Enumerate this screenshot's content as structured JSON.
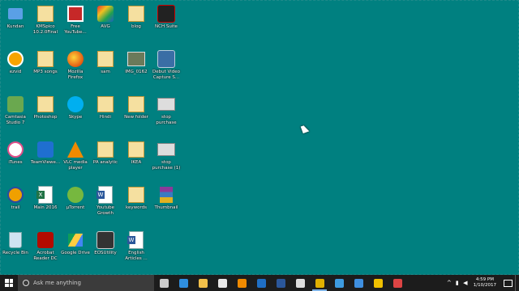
{
  "desktop": {
    "icons": [
      {
        "label": "Kundan",
        "icon": "user-folder-icon"
      },
      {
        "label": "KMSpico 10.2.0Final",
        "icon": "folder-icon"
      },
      {
        "label": "Free YouTube...",
        "icon": "free-youtube-icon"
      },
      {
        "label": "AVG",
        "icon": "avg-icon"
      },
      {
        "label": "blog",
        "icon": "folder-icon"
      },
      {
        "label": "NCH Suite",
        "icon": "nch-suite-icon"
      },
      {
        "label": "ezvid",
        "icon": "ezvid-icon"
      },
      {
        "label": "MP3 songs",
        "icon": "folder-icon"
      },
      {
        "label": "Mozilla Firefox",
        "icon": "firefox-icon"
      },
      {
        "label": "sam",
        "icon": "folder-icon"
      },
      {
        "label": "IMG_0162",
        "icon": "image-file-icon"
      },
      {
        "label": "Debut Video Capture S...",
        "icon": "debut-video-icon"
      },
      {
        "label": "Camtasia Studio 7",
        "icon": "camtasia-icon"
      },
      {
        "label": "Photoshop",
        "icon": "folder-icon"
      },
      {
        "label": "Skype",
        "icon": "skype-icon"
      },
      {
        "label": "Hindi",
        "icon": "folder-icon"
      },
      {
        "label": "New folder",
        "icon": "folder-icon"
      },
      {
        "label": "stop purchase",
        "icon": "image-file-icon"
      },
      {
        "label": "iTunes",
        "icon": "itunes-icon"
      },
      {
        "label": "TeamViewe...",
        "icon": "teamviewer-icon"
      },
      {
        "label": "VLC media player",
        "icon": "vlc-icon"
      },
      {
        "label": "PA analytic",
        "icon": "folder-icon"
      },
      {
        "label": "IKEA",
        "icon": "folder-icon"
      },
      {
        "label": "stop purchase (1)",
        "icon": "image-file-icon"
      },
      {
        "label": "trail",
        "icon": "audacity-icon"
      },
      {
        "label": "Main 2016",
        "icon": "excel-file-icon"
      },
      {
        "label": "µTorrent",
        "icon": "utorrent-icon"
      },
      {
        "label": "Youtube Growth",
        "icon": "word-file-icon"
      },
      {
        "label": "keywords",
        "icon": "folder-icon"
      },
      {
        "label": "Thumbnail",
        "icon": "winrar-icon"
      },
      {
        "label": "Recycle Bin",
        "icon": "recycle-bin-icon"
      },
      {
        "label": "Acrobat Reader DC",
        "icon": "acrobat-icon"
      },
      {
        "label": "Google Drive",
        "icon": "google-drive-icon"
      },
      {
        "label": "EOSUtility",
        "icon": "eos-utility-icon"
      },
      {
        "label": "English Articles ...",
        "icon": "word-file-icon"
      }
    ]
  },
  "taskbar": {
    "search_placeholder": "Ask me anything",
    "apps": [
      {
        "name": "task-view-icon",
        "color": "#cccccc",
        "active": false
      },
      {
        "name": "edge-icon",
        "color": "#2f8fe0",
        "active": false
      },
      {
        "name": "file-explorer-icon",
        "color": "#f3c04a",
        "active": false
      },
      {
        "name": "store-icon",
        "color": "#e8e8e8",
        "active": false
      },
      {
        "name": "vlc-icon",
        "color": "#f08a00",
        "active": false
      },
      {
        "name": "outlook-icon",
        "color": "#1f6fc5",
        "active": false
      },
      {
        "name": "word-icon",
        "color": "#2b579a",
        "active": false
      },
      {
        "name": "calculator-icon",
        "color": "#dddddd",
        "active": false
      },
      {
        "name": "chrome-icon",
        "color": "#e0b000",
        "active": true
      },
      {
        "name": "internet-explorer-icon",
        "color": "#3d9be0",
        "active": false
      },
      {
        "name": "teamviewer-icon",
        "color": "#3f8fe0",
        "active": false
      },
      {
        "name": "vectr-icon",
        "color": "#f0c000",
        "active": false
      },
      {
        "name": "snipping-tool-icon",
        "color": "#d44",
        "active": false
      }
    ],
    "clock": {
      "time": "4:59 PM",
      "date": "1/10/2017"
    }
  }
}
